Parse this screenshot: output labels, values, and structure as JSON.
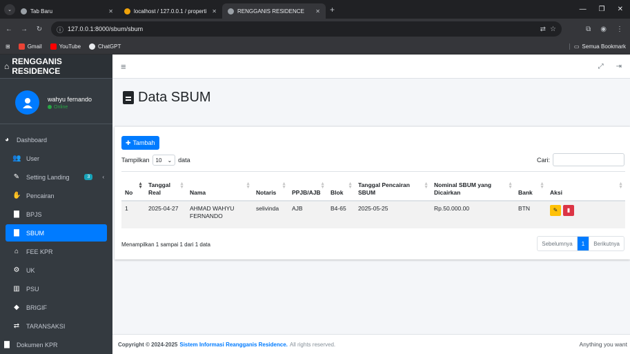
{
  "browser": {
    "tabs": [
      {
        "label": "Tab Baru"
      },
      {
        "label": "localhost / 127.0.0.1 / properti"
      },
      {
        "label": "RENGGANIS RESIDENCE"
      }
    ],
    "url": "127.0.0.1:8000/sbum/sbum",
    "bookmarks": [
      "Gmail",
      "YouTube",
      "ChatGPT"
    ],
    "all_bookmarks": "Semua Bookmark"
  },
  "sidebar": {
    "brand": "RENGGANIS RESIDENCE",
    "user_name": "wahyu fernando",
    "user_status": "Online",
    "items": [
      {
        "label": "Dashboard",
        "icon": "tachometer-icon"
      },
      {
        "label": "User",
        "icon": "users-icon"
      },
      {
        "label": "Setting Landing",
        "icon": "edit-icon",
        "badge": "3"
      },
      {
        "label": "Pencairan",
        "icon": "hand-holding-icon"
      },
      {
        "label": "BPJS",
        "icon": "file-icon"
      },
      {
        "label": "SBUM",
        "icon": "file-icon",
        "active": true
      },
      {
        "label": "FEE KPR",
        "icon": "home-icon"
      },
      {
        "label": "UK",
        "icon": "cogs-icon"
      },
      {
        "label": "PSU",
        "icon": "building-icon"
      },
      {
        "label": "BRIGIF",
        "icon": "shield-icon"
      },
      {
        "label": "TARANSAKSI",
        "icon": "exchange-icon"
      },
      {
        "label": "Dokumen KPR",
        "icon": "file-icon"
      }
    ]
  },
  "page": {
    "title": "Data SBUM",
    "add_button": "Tambah",
    "show_label": "Tampilkan",
    "show_value": "10",
    "show_suffix": "data",
    "search_label": "Cari:",
    "search_value": "",
    "table": {
      "headers": [
        "No",
        "Tanggal Real",
        "Nama",
        "Notaris",
        "PPJB/AJB",
        "Blok",
        "Tanggal Pencairan SBUM",
        "Nominal SBUM yang Dicairkan",
        "Bank",
        "Aksi"
      ],
      "rows": [
        [
          "1",
          "2025-04-27",
          "AHMAD WAHYU FERNANDO",
          "selivinda",
          "AJB",
          "B4-65",
          "2025-05-25",
          "Rp.50.000.00",
          "BTN"
        ]
      ]
    },
    "info": "Menampilkan 1 sampai 1 dari 1 data",
    "pager": {
      "prev": "Sebelumnya",
      "current": "1",
      "next": "Berikutnya"
    }
  },
  "footer": {
    "copyright": "Copyright © 2024-2025",
    "link": "Sistem Informasi Reangganis Residence.",
    "rights": "All rights reserved.",
    "right_text": "Anything you want"
  },
  "colors": {
    "primary": "#007bff",
    "sidebar": "#343a40",
    "edit": "#ffc107",
    "delete": "#dc3545"
  }
}
